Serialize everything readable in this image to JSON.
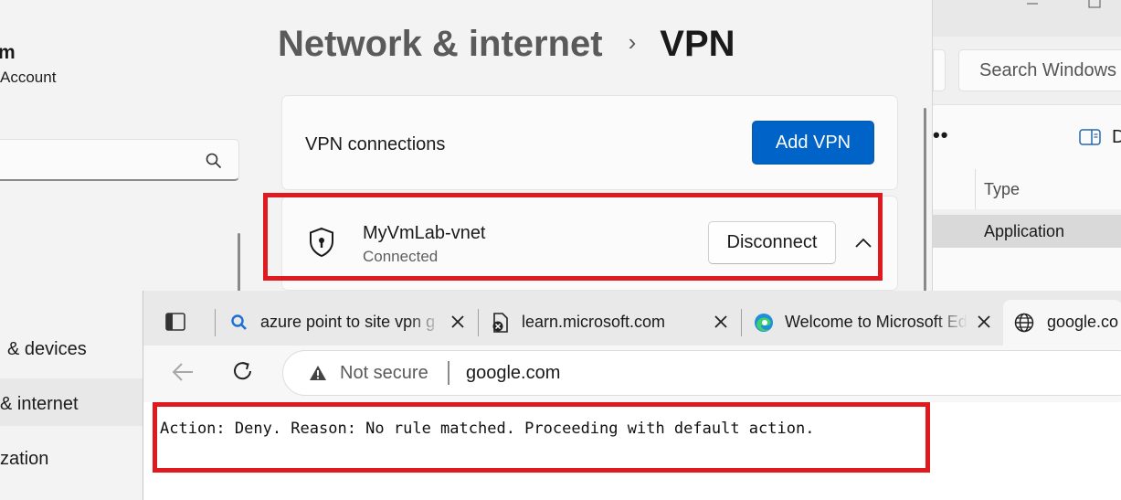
{
  "settings": {
    "account": {
      "name": "m",
      "sub": "Account"
    },
    "nav": [
      {
        "label": "& devices"
      },
      {
        "label": "& internet",
        "active": true
      },
      {
        "label": "zation"
      }
    ],
    "breadcrumb": {
      "parent": "Network & internet",
      "separator": "›",
      "current": "VPN"
    },
    "vpn_connections": {
      "label": "VPN connections",
      "add_button": "Add VPN"
    },
    "connection": {
      "name": "MyVmLab-vnet",
      "status": "Connected",
      "button": "Disconnect"
    },
    "icons": {
      "search": "search-icon",
      "shield": "shield-icon",
      "expand": "chevron-up-icon"
    },
    "colors": {
      "accent": "#0063c7",
      "highlight": "#e0191e"
    }
  },
  "event_viewer": {
    "search_placeholder": "Search Windows",
    "more": "••",
    "detail_label": "D",
    "column_type": "Type",
    "row_type": "Application"
  },
  "browser": {
    "tabs": [
      {
        "title": "azure point to site vpn g",
        "icon": "search-icon"
      },
      {
        "title": "learn.microsoft.com",
        "icon": "broken-page-icon"
      },
      {
        "title": "Welcome to Microsoft Ed",
        "icon": "edge-icon"
      },
      {
        "title": "google.co",
        "icon": "globe-icon",
        "active": true
      }
    ],
    "address": {
      "security": "Not secure",
      "url": "google.com"
    },
    "page_text": "Action: Deny. Reason: No rule matched. Proceeding with default action."
  }
}
